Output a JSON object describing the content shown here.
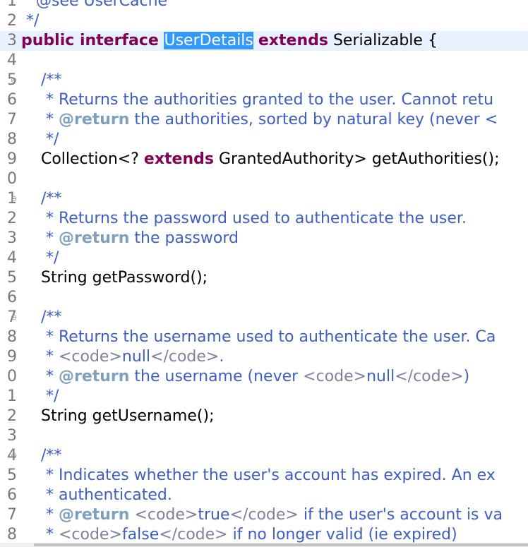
{
  "editor": {
    "lines": [
      {
        "no": "1",
        "fold": false,
        "tokens": [
          {
            "t": "   @see UserCache",
            "c": "jd"
          }
        ]
      },
      {
        "no": "2",
        "fold": false,
        "tokens": [
          {
            "t": " */",
            "c": "jd"
          }
        ]
      },
      {
        "no": "3",
        "fold": false,
        "current": true,
        "tokens": [
          {
            "t": "public interface ",
            "c": "kw"
          },
          {
            "t": "UserDetails",
            "c": "sel"
          },
          {
            "t": " "
          },
          {
            "t": "extends",
            "c": "kw"
          },
          {
            "t": " Serializable {"
          }
        ]
      },
      {
        "no": "4",
        "fold": false,
        "tokens": []
      },
      {
        "no": "5",
        "fold": true,
        "tokens": [
          {
            "t": "    /**",
            "c": "jd"
          }
        ]
      },
      {
        "no": "6",
        "fold": false,
        "tokens": [
          {
            "t": "     * Returns the authorities granted to the user. Cannot retu",
            "c": "jd"
          }
        ]
      },
      {
        "no": "7",
        "fold": false,
        "tokens": [
          {
            "t": "     * ",
            "c": "jd"
          },
          {
            "t": "@return",
            "c": "tag"
          },
          {
            "t": " the authorities, sorted by natural key (never <",
            "c": "jd"
          }
        ]
      },
      {
        "no": "8",
        "fold": false,
        "tokens": [
          {
            "t": "     */",
            "c": "jd"
          }
        ]
      },
      {
        "no": "9",
        "fold": false,
        "tokens": [
          {
            "t": "    Collection<? "
          },
          {
            "t": "extends",
            "c": "kw"
          },
          {
            "t": " GrantedAuthority> getAuthorities();"
          }
        ]
      },
      {
        "no": "0",
        "fold": false,
        "tokens": []
      },
      {
        "no": "1",
        "fold": true,
        "tokens": [
          {
            "t": "    /**",
            "c": "jd"
          }
        ]
      },
      {
        "no": "2",
        "fold": false,
        "tokens": [
          {
            "t": "     * Returns the password used to authenticate the user.",
            "c": "jd"
          }
        ]
      },
      {
        "no": "3",
        "fold": false,
        "tokens": [
          {
            "t": "     * ",
            "c": "jd"
          },
          {
            "t": "@return",
            "c": "tag"
          },
          {
            "t": " the password",
            "c": "jd"
          }
        ]
      },
      {
        "no": "4",
        "fold": false,
        "tokens": [
          {
            "t": "     */",
            "c": "jd"
          }
        ]
      },
      {
        "no": "5",
        "fold": false,
        "tokens": [
          {
            "t": "    String getPassword();"
          }
        ]
      },
      {
        "no": "6",
        "fold": false,
        "tokens": []
      },
      {
        "no": "7",
        "fold": true,
        "tokens": [
          {
            "t": "    /**",
            "c": "jd"
          }
        ]
      },
      {
        "no": "8",
        "fold": false,
        "tokens": [
          {
            "t": "     * Returns the username used to authenticate the user. Ca",
            "c": "jd"
          }
        ]
      },
      {
        "no": "9",
        "fold": false,
        "tokens": [
          {
            "t": "     * ",
            "c": "jd"
          },
          {
            "t": "<code>",
            "c": "html"
          },
          {
            "t": "null",
            "c": "jd"
          },
          {
            "t": "</code>",
            "c": "html"
          },
          {
            "t": ".",
            "c": "jd"
          }
        ]
      },
      {
        "no": "0",
        "fold": false,
        "tokens": [
          {
            "t": "     * ",
            "c": "jd"
          },
          {
            "t": "@return",
            "c": "tag"
          },
          {
            "t": " the username (never ",
            "c": "jd"
          },
          {
            "t": "<code>",
            "c": "html"
          },
          {
            "t": "null",
            "c": "jd"
          },
          {
            "t": "</code>",
            "c": "html"
          },
          {
            "t": ")",
            "c": "jd"
          }
        ]
      },
      {
        "no": "1",
        "fold": false,
        "tokens": [
          {
            "t": "     */",
            "c": "jd"
          }
        ]
      },
      {
        "no": "2",
        "fold": false,
        "tokens": [
          {
            "t": "    String getUsername();"
          }
        ]
      },
      {
        "no": "3",
        "fold": false,
        "tokens": []
      },
      {
        "no": "4",
        "fold": true,
        "tokens": [
          {
            "t": "    /**",
            "c": "jd"
          }
        ]
      },
      {
        "no": "5",
        "fold": false,
        "tokens": [
          {
            "t": "     * Indicates whether the user's account has expired. An ex",
            "c": "jd"
          }
        ]
      },
      {
        "no": "6",
        "fold": false,
        "tokens": [
          {
            "t": "     * authenticated.",
            "c": "jd"
          }
        ]
      },
      {
        "no": "7",
        "fold": false,
        "tokens": [
          {
            "t": "     * ",
            "c": "jd"
          },
          {
            "t": "@return",
            "c": "tag"
          },
          {
            "t": " ",
            "c": "jd"
          },
          {
            "t": "<code>",
            "c": "html"
          },
          {
            "t": "true",
            "c": "jd"
          },
          {
            "t": "</code>",
            "c": "html"
          },
          {
            "t": " if the user's account is va",
            "c": "jd"
          }
        ]
      },
      {
        "no": "8",
        "fold": false,
        "tokens": [
          {
            "t": "     * ",
            "c": "jd"
          },
          {
            "t": "<code>",
            "c": "html"
          },
          {
            "t": "false",
            "c": "jd"
          },
          {
            "t": "</code>",
            "c": "html"
          },
          {
            "t": " if no longer valid (ie expired)",
            "c": "jd"
          }
        ]
      }
    ]
  },
  "colors": {
    "keyword": "#7f0055",
    "javadoc": "#3f5fbf",
    "javadoc_tag": "#7f9fbf",
    "html_tag": "#7f7f9f",
    "selection": "#3399ff",
    "current_line": "#e8f2fe"
  },
  "icons": {
    "fold": "collapse-icon"
  }
}
